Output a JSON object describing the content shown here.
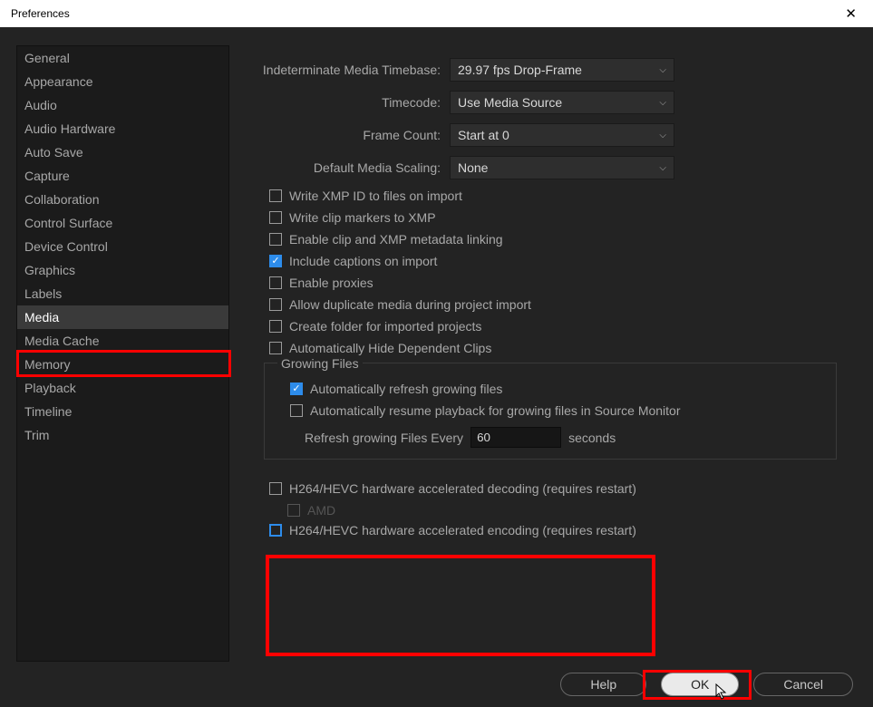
{
  "titlebar": {
    "title": "Preferences"
  },
  "sidebar": {
    "items": [
      "General",
      "Appearance",
      "Audio",
      "Audio Hardware",
      "Auto Save",
      "Capture",
      "Collaboration",
      "Control Surface",
      "Device Control",
      "Graphics",
      "Labels",
      "Media",
      "Media Cache",
      "Memory",
      "Playback",
      "Timeline",
      "Trim"
    ],
    "selected": "Media"
  },
  "dropdowns": {
    "timebase": {
      "label": "Indeterminate Media Timebase:",
      "value": "29.97 fps Drop-Frame"
    },
    "timecode": {
      "label": "Timecode:",
      "value": "Use Media Source"
    },
    "framecount": {
      "label": "Frame Count:",
      "value": "Start at 0"
    },
    "scaling": {
      "label": "Default Media Scaling:",
      "value": "None"
    }
  },
  "checks": {
    "xmp_id": {
      "label": "Write XMP ID to files on import",
      "checked": false
    },
    "clip_markers": {
      "label": "Write clip markers to XMP",
      "checked": false
    },
    "clip_linking": {
      "label": "Enable clip and XMP metadata linking",
      "checked": false
    },
    "captions": {
      "label": "Include captions on import",
      "checked": true
    },
    "proxies": {
      "label": "Enable proxies",
      "checked": false
    },
    "dup_media": {
      "label": "Allow duplicate media during project import",
      "checked": false
    },
    "create_folder": {
      "label": "Create folder for imported projects",
      "checked": false
    },
    "hide_clips": {
      "label": "Automatically Hide Dependent Clips",
      "checked": false
    }
  },
  "growing": {
    "legend": "Growing Files",
    "auto_refresh": {
      "label": "Automatically refresh growing files",
      "checked": true
    },
    "auto_resume": {
      "label": "Automatically resume playback for growing files in Source Monitor",
      "checked": false
    },
    "refresh_label_pre": "Refresh growing Files Every",
    "refresh_value": "60",
    "refresh_label_post": "seconds"
  },
  "hw": {
    "decode": {
      "label": "H264/HEVC hardware accelerated decoding (requires restart)",
      "checked": false
    },
    "amd": {
      "label": "AMD",
      "checked": false
    },
    "encode": {
      "label": "H264/HEVC hardware accelerated encoding (requires restart)",
      "checked": false
    }
  },
  "footer": {
    "help": "Help",
    "ok": "OK",
    "cancel": "Cancel"
  }
}
